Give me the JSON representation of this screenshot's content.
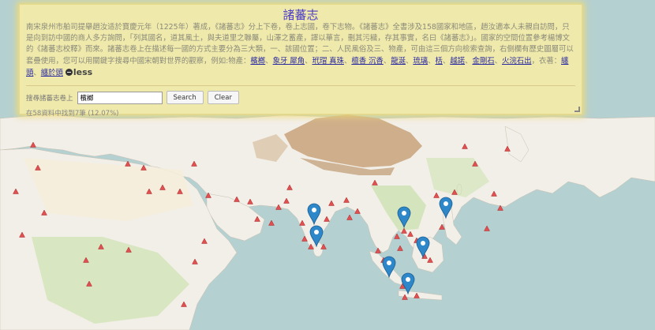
{
  "panel": {
    "title": "諸蕃志",
    "description": "南宋泉州市舶司提舉趙汝适於寶慶元年（1225年）著成，《諸蕃志》分上下卷，卷上志國，卷下志物。《諸蕃志》全書涉及158國家和地區，趙汝適本人未親自訪問，只是向到訪中國的商人多方詢問，「列其國名，道其風土，與夫道里之聯屬，山澤之蓄產，譯以華言，刪其污穢，存其事實，名曰《諸蕃志》」。國家的空間位置參考楊博文的《諸蕃志校釋》而來。諸蕃志卷上在描述每一國的方式主要分為三大類，一、該國位置；二、人民風俗及三、物產，可由這三個方向檢索查詢，右側欄有歷史圖層可以套疊使用，您可以用關鍵字搜尋中國宋朝對世界的觀察，例如:物產：",
    "product_links": [
      "檳榔",
      "象牙 犀角",
      "玳瑁 真珠",
      "檀香 沉香",
      "龍涎",
      "琉璃",
      "栝",
      "越諾",
      "金剛石",
      "火浣石出"
    ],
    "clothing_prefix": "衣著：",
    "clothing_links": [
      "纏頭",
      "纏於頭"
    ],
    "less_label": "less",
    "search_label": "搜尋諸蕃志卷上",
    "search_value": "檳榔",
    "search_button": "Search",
    "clear_button": "Clear",
    "result_text": "在58資料中找到7筆 (12.07%)"
  },
  "map": {
    "water_color": "#b5d0d0",
    "land_color": "#f2efe9",
    "marker_color": "#2d87c8",
    "triangle_color": "#e05050",
    "markers": [
      "India west coast",
      "Sri Lanka",
      "Indochina",
      "Philippines",
      "Borneo",
      "Sumatra",
      "Java"
    ]
  }
}
